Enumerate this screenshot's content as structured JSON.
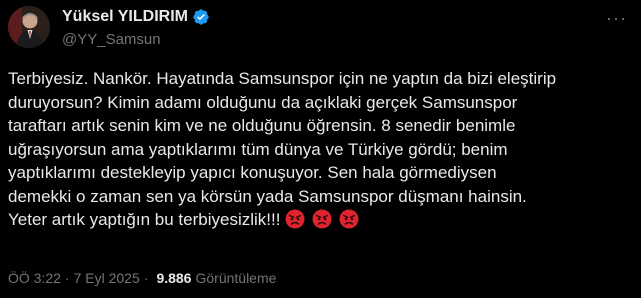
{
  "author": {
    "display_name": "Yüksel YILDIRIM",
    "handle": "@YY_Samsun",
    "verified_color": "#1d9bf0"
  },
  "menu": {
    "more_label": "···"
  },
  "tweet": {
    "lines": [
      "Terbiyesiz. Nankör. Hayatında Samsunspor için ne yaptın da bizi eleştirip",
      "duruyorsun? Kimin adamı olduğunu da açıklaki gerçek Samsunspor",
      "taraftarı artık senin kim ve ne olduğunu öğrensin. 8 senedir benimle",
      "uğraşıyorsun ama yaptıklarımı tüm dünya ve Türkiye gördü; benim",
      "yaptıklarımı destekleyip yapıcı konuşuyor. Sen hala görmediysen",
      "demekki o zaman sen ya körsün yada Samsunspor düşmanı hainsin.",
      "Yeter artık yaptığın bu terbiyesizlik!!! "
    ],
    "emojis": [
      "angry-face",
      "angry-face",
      "angry-face"
    ]
  },
  "meta": {
    "time": "ÖÖ 3:22",
    "separator": "·",
    "date": "7 Eyl 2025",
    "views_count": "9.886",
    "views_label": "Görüntüleme"
  },
  "colors": {
    "background": "#000000",
    "text": "#e7e9ea",
    "secondary": "#71767b",
    "emoji_red": "#e0242f"
  }
}
